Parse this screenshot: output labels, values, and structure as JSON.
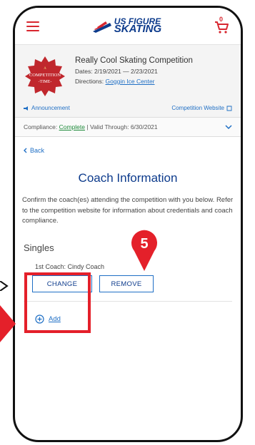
{
  "header": {
    "logo_line1": "US FIGURE",
    "logo_line2": "SKATING",
    "cart_count": "0"
  },
  "competition": {
    "badge_text_top": "COMPETITION",
    "badge_text_bottom": "-TIME-",
    "badge_text_a": "A",
    "title": "Really Cool Skating Competition",
    "dates_label": "Dates:",
    "dates_value": "2/19/2021 — 2/23/2021",
    "directions_label": "Directions:",
    "directions_link": "Goggin Ice Center",
    "announcement_label": "Announcement",
    "website_label": "Competition Website"
  },
  "compliance": {
    "label": "Compliance:",
    "status": "Complete",
    "valid_through": "| Valid Through: 6/30/2021"
  },
  "nav": {
    "back_label": "Back"
  },
  "page": {
    "title": "Coach Information",
    "intro": "Confirm the coach(es) attending the competition with you below. Refer to the competition website for information about credentials and coach compliance."
  },
  "singles": {
    "section_title": "Singles",
    "coach_line": "1st Coach: Cindy Coach",
    "change_label": "CHANGE",
    "remove_label": "REMOVE",
    "add_label": "Add"
  },
  "annotation": {
    "step_number": "5"
  },
  "colors": {
    "brand_blue": "#0d3b8c",
    "link_blue": "#1f6fc5",
    "accent_red": "#d8262f",
    "annotation_red": "#e4202a",
    "compliance_green": "#1e8a3a"
  }
}
